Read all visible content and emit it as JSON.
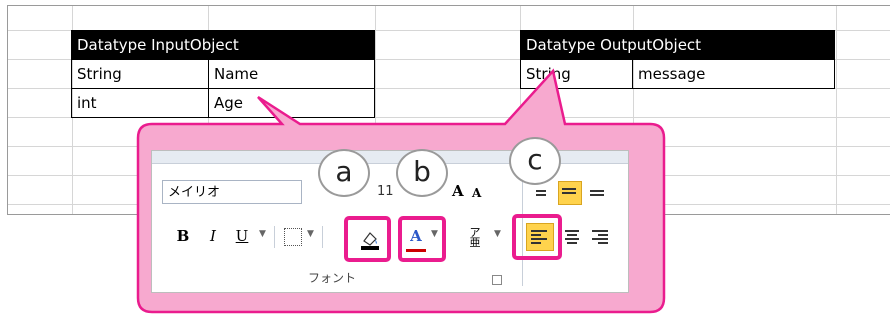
{
  "table_input": {
    "header": "Datatype InputObject",
    "rows": [
      {
        "type": "String",
        "name": "Name"
      },
      {
        "type": "int",
        "name": "Age"
      }
    ]
  },
  "table_output": {
    "header": "Datatype OutputObject",
    "rows": [
      {
        "type": "String",
        "name": "message"
      }
    ]
  },
  "ribbon": {
    "font_name": "メイリオ",
    "font_size": "11",
    "grow_label": "A",
    "shrink_label": "A",
    "bold_label": "B",
    "italic_label": "I",
    "underline_label": "U",
    "font_color_label": "A",
    "phonetic_label": "ア亜",
    "group_label": "フォント"
  },
  "bubbles": {
    "a": "a",
    "b": "b",
    "c": "c"
  },
  "colors": {
    "highlight": "#ea1c8e",
    "callout_fill": "#f7a9cf",
    "callout_border": "#ea1c8e",
    "align_active": "#ffd34d"
  },
  "icons": [
    "fill-color-icon",
    "font-color-icon",
    "align-left-icon",
    "align-center-icon",
    "align-right-icon",
    "border-icon"
  ]
}
